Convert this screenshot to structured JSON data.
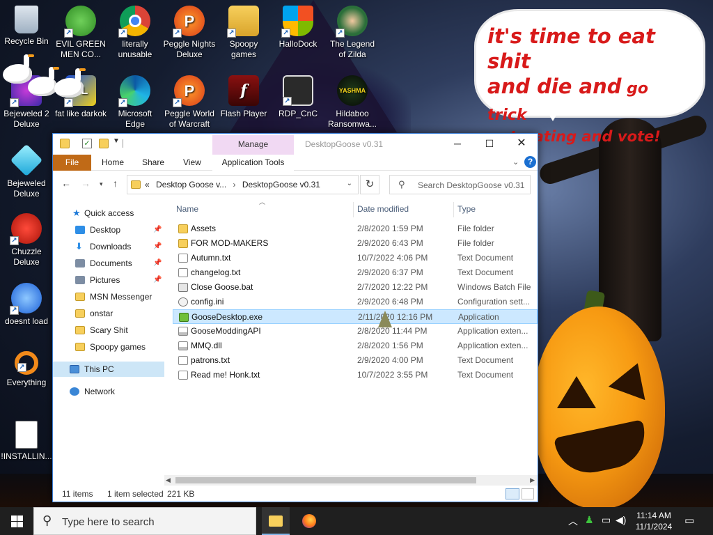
{
  "desktop": {
    "speech_bubble": {
      "line1": "it's time to eat shit",
      "line2a": "and die and",
      "line2b": " go trick",
      "line3": "or treating and vote!"
    },
    "icons": [
      {
        "label": "Recycle Bin",
        "icon": "recycle-bin-icon"
      },
      {
        "label": "EVIL GREEN MEN CO...",
        "icon": "msn-people-icon"
      },
      {
        "label": "literally unusable",
        "icon": "chrome-icon"
      },
      {
        "label": "Peggle Nights Deluxe",
        "icon": "peggle-icon"
      },
      {
        "label": "Spoopy games",
        "icon": "folder-icon"
      },
      {
        "label": "HalloDock",
        "icon": "windows-shield-icon"
      },
      {
        "label": "The Legend of Zilda",
        "icon": "character-icon"
      },
      {
        "label": "Bejeweled 2 Deluxe",
        "icon": "bejeweled-icon"
      },
      {
        "label": "fat like darkok",
        "icon": "game-icon"
      },
      {
        "label": "Microsoft Edge",
        "icon": "edge-icon"
      },
      {
        "label": "Peggle World of Warcraft",
        "icon": "peggle-icon"
      },
      {
        "label": "Flash Player",
        "icon": "flash-icon"
      },
      {
        "label": "RDP_CnC",
        "icon": "remote-desktop-icon"
      },
      {
        "label": "Hildaboo Ransomwa...",
        "icon": "yashma-icon"
      },
      {
        "label": "Bejeweled Deluxe",
        "icon": "gem-icon"
      },
      {
        "label": "Chuzzle Deluxe",
        "icon": "chuzzle-icon"
      },
      {
        "label": "doesnt load",
        "icon": "thunderbird-icon"
      },
      {
        "label": "Everything",
        "icon": "search-magnifier-icon"
      },
      {
        "label": "!INSTALLIN...",
        "icon": "text-file-icon"
      }
    ]
  },
  "window": {
    "title": "DesktopGoose v0.31",
    "manage_tab": "Manage",
    "ribbon_tabs": {
      "file": "File",
      "home": "Home",
      "share": "Share",
      "view": "View",
      "app_tools": "Application Tools"
    },
    "address": {
      "crumb1": "Desktop Goose v...",
      "crumb2": "DesktopGoose v0.31",
      "prefix": "«"
    },
    "search_placeholder": "Search DesktopGoose v0.31",
    "nav": {
      "quick_access": "Quick access",
      "desktop": "Desktop",
      "downloads": "Downloads",
      "documents": "Documents",
      "pictures": "Pictures",
      "msn": "MSN Messenger",
      "onstar": "onstar",
      "scary": "Scary Shit",
      "spoopy": "Spoopy games",
      "this_pc": "This PC",
      "network": "Network"
    },
    "columns": {
      "name": "Name",
      "date": "Date modified",
      "type": "Type"
    },
    "files": [
      {
        "name": "Assets",
        "date": "2/8/2020 1:59 PM",
        "type": "File folder",
        "icon": "folder"
      },
      {
        "name": "FOR MOD-MAKERS",
        "date": "2/9/2020 6:43 PM",
        "type": "File folder",
        "icon": "folder"
      },
      {
        "name": "Autumn.txt",
        "date": "10/7/2022 4:06 PM",
        "type": "Text Document",
        "icon": "doc"
      },
      {
        "name": "changelog.txt",
        "date": "2/9/2020 6:37 PM",
        "type": "Text Document",
        "icon": "doc"
      },
      {
        "name": "Close Goose.bat",
        "date": "2/7/2020 12:22 PM",
        "type": "Windows Batch File",
        "icon": "bat"
      },
      {
        "name": "config.ini",
        "date": "2/9/2020 6:48 PM",
        "type": "Configuration sett...",
        "icon": "cfg"
      },
      {
        "name": "GooseDesktop.exe",
        "date": "2/11/2020 12:16 PM",
        "type": "Application",
        "icon": "exe"
      },
      {
        "name": "GooseModdingAPI",
        "date": "2/8/2020 11:44 PM",
        "type": "Application exten...",
        "icon": "dll"
      },
      {
        "name": "MMQ.dll",
        "date": "2/8/2020 1:56 PM",
        "type": "Application exten...",
        "icon": "dll"
      },
      {
        "name": "patrons.txt",
        "date": "2/9/2020 4:00 PM",
        "type": "Text Document",
        "icon": "doc"
      },
      {
        "name": "Read me! Honk.txt",
        "date": "10/7/2022 3:55 PM",
        "type": "Text Document",
        "icon": "doc"
      }
    ],
    "status": {
      "items": "11 items",
      "selected": "1 item selected",
      "size": "221 KB"
    }
  },
  "taskbar": {
    "search_placeholder": "Type here to search",
    "time": "11:14 AM",
    "date": "11/1/2024"
  }
}
